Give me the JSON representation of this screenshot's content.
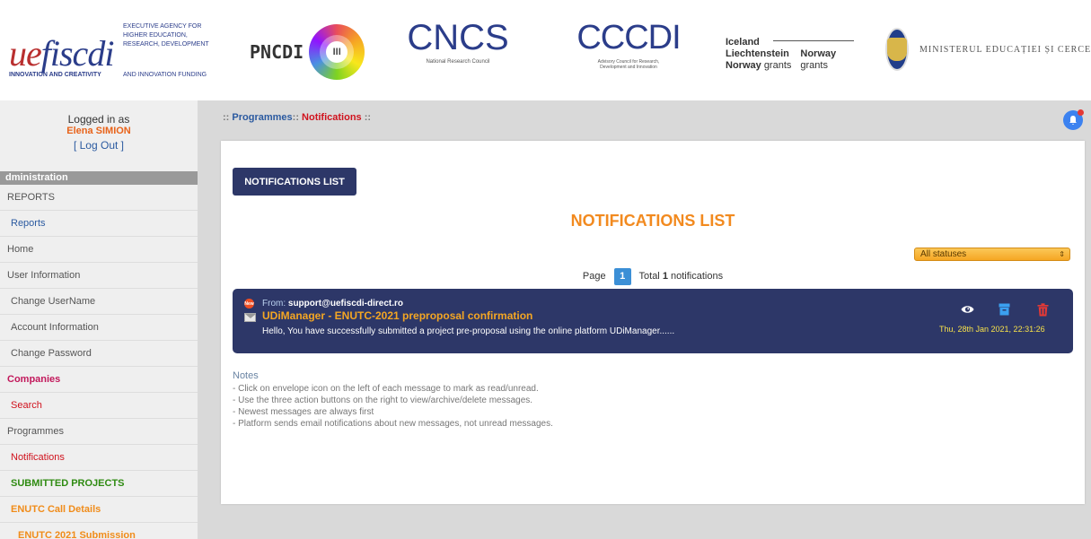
{
  "header": {
    "uefiscdi": {
      "mark_a": "ue",
      "mark_b": "fiscdi",
      "tagline": "INNOVATION AND CREATIVITY",
      "agency_lines": [
        "EXECUTIVE AGENCY FOR",
        "HIGHER EDUCATION,",
        "RESEARCH, DEVELOPMENT"
      ],
      "agency_last": "AND INNOVATION FUNDING"
    },
    "pncdi": {
      "text": "PNCDI",
      "numeral": "III"
    },
    "cncs": {
      "text": "CNCS",
      "sub": "National Research Council"
    },
    "cccdi": {
      "text": "CCCDI",
      "sub_1": "Advisory Council for Research,",
      "sub_2": "Development and Innovation"
    },
    "grants": {
      "col1": [
        "Iceland",
        "Liechtenstein",
        "Norway"
      ],
      "col1_suffix": "grants",
      "col2": [
        "Norway",
        "grants"
      ]
    },
    "ministry": {
      "text": "Ministerul Educației și Cercetă"
    }
  },
  "sidebar": {
    "logged_in_label": "Logged in as",
    "user_name": "Elena SIMION",
    "logout_label": "[ Log Out ]",
    "section_label": "dministration",
    "items": [
      {
        "label": "REPORTS",
        "style": "gray"
      },
      {
        "label": "Reports",
        "style": "blue"
      },
      {
        "label": "Home",
        "style": "gray"
      },
      {
        "label": "User Information",
        "style": "gray"
      },
      {
        "label": "Change UserName",
        "style": "indent"
      },
      {
        "label": "Account Information",
        "style": "indent"
      },
      {
        "label": "Change Password",
        "style": "indent"
      },
      {
        "label": "Companies",
        "style": "pink"
      },
      {
        "label": "Search",
        "style": "red"
      },
      {
        "label": "Programmes",
        "style": "gray"
      },
      {
        "label": "Notifications",
        "style": "red"
      },
      {
        "label": "SUBMITTED PROJECTS",
        "style": "green"
      },
      {
        "label": "ENUTC Call Details",
        "style": "orange"
      },
      {
        "label": "ENUTC 2021 Submission",
        "style": "orange2"
      }
    ]
  },
  "breadcrumb": {
    "sep": "::",
    "link": "Programmes",
    "current": "Notifications"
  },
  "main": {
    "tab_label": "NOTIFICATIONS LIST",
    "title": "NOTIFICATIONS LIST",
    "status_select": {
      "selected": "All statuses"
    },
    "pager": {
      "page_label": "Page",
      "page": "1",
      "total_prefix": "Total",
      "total_count": "1",
      "total_suffix": "notifications"
    },
    "message": {
      "badge": "New",
      "from_label": "From:",
      "from": "support@uefiscdi-direct.ro",
      "subject": "UDiManager - ENUTC-2021 preproposal confirmation",
      "body": "Hello, You have successfully submitted a project pre-proposal using the online platform UDiManager......",
      "date": "Thu, 28th Jan 2021, 22:31:26"
    },
    "notes": {
      "title": "Notes",
      "lines": [
        "- Click on envelope icon on the left of each message to mark as read/unread.",
        "- Use the three action buttons on the right to view/archive/delete messages.",
        "- Newest messages are always first",
        "- Platform sends email notifications about new messages, not unread messages."
      ]
    }
  },
  "colors": {
    "navy": "#2d3768",
    "orange": "#f28a1f",
    "red": "#d0121d",
    "blue": "#2b5aa0"
  }
}
